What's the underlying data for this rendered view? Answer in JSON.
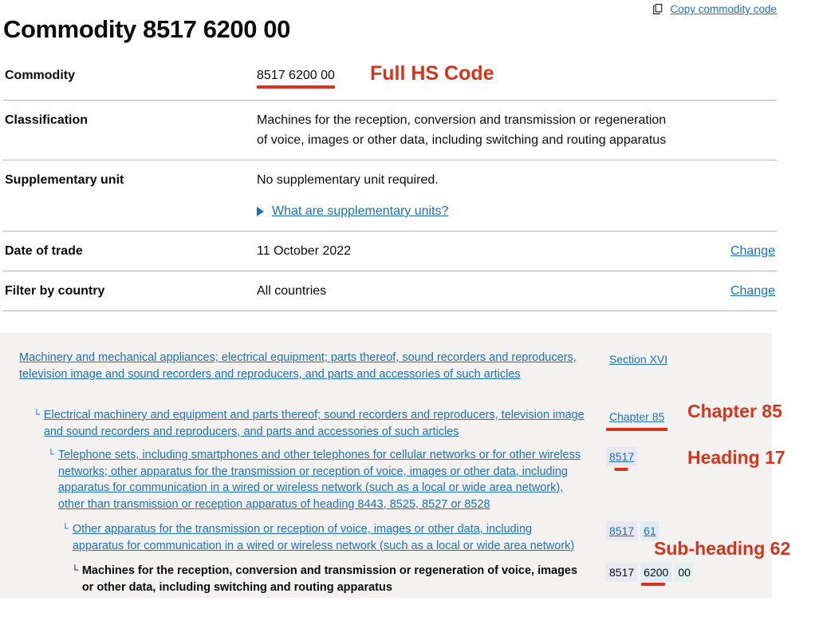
{
  "header": {
    "title": "Commodity 8517 6200 00",
    "copy_link_label": "Copy commodity code",
    "copy_icon": "copy-icon"
  },
  "details": {
    "rows": [
      {
        "key": "Commodity",
        "value": "8517 6200 00",
        "action": ""
      },
      {
        "key": "Classification",
        "value": "Machines for the reception, conversion and transmission or regeneration of voice, images or other data, including switching and routing apparatus",
        "action": ""
      },
      {
        "key": "Supplementary unit",
        "value": "No supplementary unit required.",
        "toggle_label": "What are supplementary units?",
        "action": ""
      },
      {
        "key": "Date of trade",
        "value": "11 October 2022",
        "action": "Change"
      },
      {
        "key": "Filter by country",
        "value": "All countries",
        "action": "Change"
      }
    ]
  },
  "hierarchy": {
    "nodes": [
      {
        "text": "Machinery and mechanical appliances; electrical equipment; parts thereof, sound recorders and reproducers, television image and sound recorders and reproducers, and parts and accessories of such articles",
        "code_label": "Section XVI",
        "level": 0,
        "current": false
      },
      {
        "text": "Electrical machinery and equipment and parts thereof; sound recorders and reproducers, television image and sound recorders and reproducers, and parts and accessories of such articles",
        "code_label": "Chapter 85",
        "level": 1,
        "current": false
      },
      {
        "text": "Telephone sets, including smartphones and other telephones for cellular networks or for other wireless networks; other apparatus for the transmission or reception of voice, images or other data, including apparatus for communication in a wired or wireless network (such as a local or wide area network), other than transmission or reception apparatus of heading 8443, 8525, 8527 or 8528",
        "code_segments": [
          "8517"
        ],
        "level": 2,
        "current": false
      },
      {
        "text": "Other apparatus for the transmission or reception of voice, images or other data, including apparatus for communication in a wired or wireless network (such as a local or wide area network)",
        "code_segments": [
          "8517",
          "61"
        ],
        "level": 3,
        "current": false
      },
      {
        "text": "Machines for the reception, conversion and transmission or regeneration of voice, images or other data, including switching and routing apparatus",
        "code_segments": [
          "8517",
          "6200",
          "00"
        ],
        "level": 4,
        "current": true
      }
    ],
    "elbow_glyph": "└"
  },
  "annotations": {
    "full_hs_code": "Full HS Code",
    "chapter": "Chapter 85",
    "heading": "Heading 17",
    "subheading": "Sub-heading 62"
  },
  "colors": {
    "link": "#1d70b8",
    "annotation_red": "#d4351c",
    "panel_bg": "#f3f2f1",
    "segment_a": "#e8e7f2",
    "segment_b": "#dfecf7",
    "segment_c": "#dff3ef"
  }
}
